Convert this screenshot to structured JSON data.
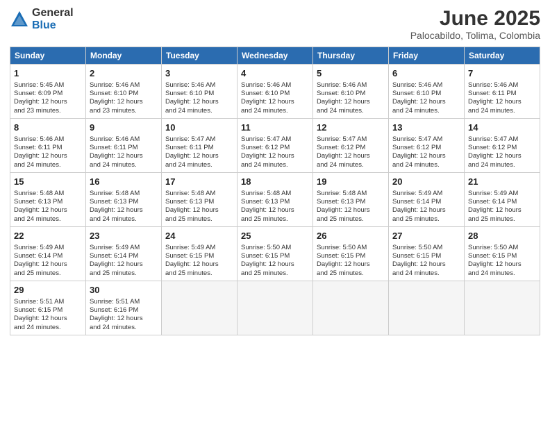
{
  "logo": {
    "general": "General",
    "blue": "Blue"
  },
  "title": "June 2025",
  "subtitle": "Palocabildo, Tolima, Colombia",
  "days_of_week": [
    "Sunday",
    "Monday",
    "Tuesday",
    "Wednesday",
    "Thursday",
    "Friday",
    "Saturday"
  ],
  "weeks": [
    [
      {
        "day": "1",
        "info": "Sunrise: 5:45 AM\nSunset: 6:09 PM\nDaylight: 12 hours\nand 23 minutes."
      },
      {
        "day": "2",
        "info": "Sunrise: 5:46 AM\nSunset: 6:10 PM\nDaylight: 12 hours\nand 23 minutes."
      },
      {
        "day": "3",
        "info": "Sunrise: 5:46 AM\nSunset: 6:10 PM\nDaylight: 12 hours\nand 24 minutes."
      },
      {
        "day": "4",
        "info": "Sunrise: 5:46 AM\nSunset: 6:10 PM\nDaylight: 12 hours\nand 24 minutes."
      },
      {
        "day": "5",
        "info": "Sunrise: 5:46 AM\nSunset: 6:10 PM\nDaylight: 12 hours\nand 24 minutes."
      },
      {
        "day": "6",
        "info": "Sunrise: 5:46 AM\nSunset: 6:10 PM\nDaylight: 12 hours\nand 24 minutes."
      },
      {
        "day": "7",
        "info": "Sunrise: 5:46 AM\nSunset: 6:11 PM\nDaylight: 12 hours\nand 24 minutes."
      }
    ],
    [
      {
        "day": "8",
        "info": "Sunrise: 5:46 AM\nSunset: 6:11 PM\nDaylight: 12 hours\nand 24 minutes."
      },
      {
        "day": "9",
        "info": "Sunrise: 5:46 AM\nSunset: 6:11 PM\nDaylight: 12 hours\nand 24 minutes."
      },
      {
        "day": "10",
        "info": "Sunrise: 5:47 AM\nSunset: 6:11 PM\nDaylight: 12 hours\nand 24 minutes."
      },
      {
        "day": "11",
        "info": "Sunrise: 5:47 AM\nSunset: 6:12 PM\nDaylight: 12 hours\nand 24 minutes."
      },
      {
        "day": "12",
        "info": "Sunrise: 5:47 AM\nSunset: 6:12 PM\nDaylight: 12 hours\nand 24 minutes."
      },
      {
        "day": "13",
        "info": "Sunrise: 5:47 AM\nSunset: 6:12 PM\nDaylight: 12 hours\nand 24 minutes."
      },
      {
        "day": "14",
        "info": "Sunrise: 5:47 AM\nSunset: 6:12 PM\nDaylight: 12 hours\nand 24 minutes."
      }
    ],
    [
      {
        "day": "15",
        "info": "Sunrise: 5:48 AM\nSunset: 6:13 PM\nDaylight: 12 hours\nand 24 minutes."
      },
      {
        "day": "16",
        "info": "Sunrise: 5:48 AM\nSunset: 6:13 PM\nDaylight: 12 hours\nand 24 minutes."
      },
      {
        "day": "17",
        "info": "Sunrise: 5:48 AM\nSunset: 6:13 PM\nDaylight: 12 hours\nand 25 minutes."
      },
      {
        "day": "18",
        "info": "Sunrise: 5:48 AM\nSunset: 6:13 PM\nDaylight: 12 hours\nand 25 minutes."
      },
      {
        "day": "19",
        "info": "Sunrise: 5:48 AM\nSunset: 6:13 PM\nDaylight: 12 hours\nand 25 minutes."
      },
      {
        "day": "20",
        "info": "Sunrise: 5:49 AM\nSunset: 6:14 PM\nDaylight: 12 hours\nand 25 minutes."
      },
      {
        "day": "21",
        "info": "Sunrise: 5:49 AM\nSunset: 6:14 PM\nDaylight: 12 hours\nand 25 minutes."
      }
    ],
    [
      {
        "day": "22",
        "info": "Sunrise: 5:49 AM\nSunset: 6:14 PM\nDaylight: 12 hours\nand 25 minutes."
      },
      {
        "day": "23",
        "info": "Sunrise: 5:49 AM\nSunset: 6:14 PM\nDaylight: 12 hours\nand 25 minutes."
      },
      {
        "day": "24",
        "info": "Sunrise: 5:49 AM\nSunset: 6:15 PM\nDaylight: 12 hours\nand 25 minutes."
      },
      {
        "day": "25",
        "info": "Sunrise: 5:50 AM\nSunset: 6:15 PM\nDaylight: 12 hours\nand 25 minutes."
      },
      {
        "day": "26",
        "info": "Sunrise: 5:50 AM\nSunset: 6:15 PM\nDaylight: 12 hours\nand 25 minutes."
      },
      {
        "day": "27",
        "info": "Sunrise: 5:50 AM\nSunset: 6:15 PM\nDaylight: 12 hours\nand 24 minutes."
      },
      {
        "day": "28",
        "info": "Sunrise: 5:50 AM\nSunset: 6:15 PM\nDaylight: 12 hours\nand 24 minutes."
      }
    ],
    [
      {
        "day": "29",
        "info": "Sunrise: 5:51 AM\nSunset: 6:15 PM\nDaylight: 12 hours\nand 24 minutes."
      },
      {
        "day": "30",
        "info": "Sunrise: 5:51 AM\nSunset: 6:16 PM\nDaylight: 12 hours\nand 24 minutes."
      },
      {
        "day": "",
        "info": ""
      },
      {
        "day": "",
        "info": ""
      },
      {
        "day": "",
        "info": ""
      },
      {
        "day": "",
        "info": ""
      },
      {
        "day": "",
        "info": ""
      }
    ]
  ]
}
